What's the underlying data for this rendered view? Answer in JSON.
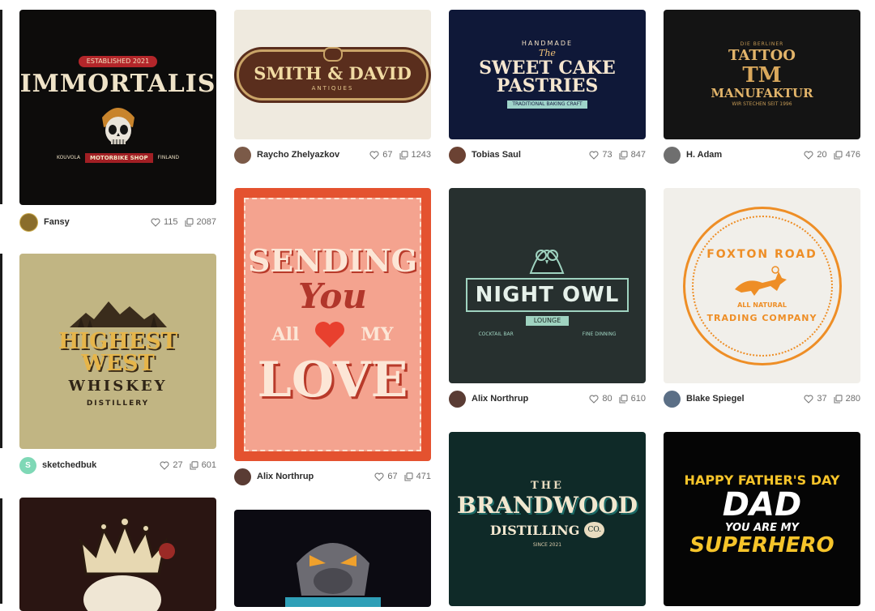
{
  "shots": [
    {
      "author": "Fansy",
      "avatar_letter": "",
      "avatar_color": "#8a6d2b",
      "likes": "115",
      "views": "2087",
      "art_lines": [
        "ESTABLISHED 2021",
        "IMMORTALIS",
        "KOUVOLA",
        "MOTORBIKE SHOP",
        "FINLAND"
      ]
    },
    {
      "author": "sketchedbuk",
      "avatar_letter": "S",
      "avatar_color": "#7fd8b6",
      "likes": "27",
      "views": "601",
      "art_lines": [
        "HIGHEST WEST",
        "WHISKEY",
        "DISTILLERY"
      ]
    },
    {
      "author": "Raycho Zhelyazkov",
      "avatar_letter": "",
      "avatar_color": "#7b5a48",
      "likes": "67",
      "views": "1243",
      "art_lines": [
        "SMITH & DAVID",
        "ANTIQUES"
      ]
    },
    {
      "author": "Alix Northrup",
      "avatar_letter": "",
      "avatar_color": "#5a3c34",
      "likes": "67",
      "views": "471",
      "art_lines": [
        "SENDING",
        "You",
        "All",
        "MY",
        "LOVE"
      ]
    },
    {
      "author": "Tobias Saul",
      "avatar_letter": "",
      "avatar_color": "#6b4233",
      "likes": "73",
      "views": "847",
      "art_lines": [
        "HANDMADE",
        "The",
        "SWEET CAKE",
        "PASTRIES",
        "TRADITIONAL BAKING CRAFT"
      ]
    },
    {
      "author": "Alix Northrup",
      "avatar_letter": "",
      "avatar_color": "#5a3c34",
      "likes": "80",
      "views": "610",
      "art_lines": [
        "NIGHT OWL",
        "LOUNGE",
        "COCKTAIL BAR",
        "FINE DINNING"
      ]
    },
    {
      "author": "H. Adam",
      "avatar_letter": "",
      "avatar_color": "#6f6f6f",
      "likes": "20",
      "views": "476",
      "art_lines": [
        "DIE BERLINER",
        "TATTOO",
        "MANUFAKTUR",
        "WIR STECHEN SEIT 1996"
      ]
    },
    {
      "author": "Blake Spiegel",
      "avatar_letter": "",
      "avatar_color": "#5b6f86",
      "likes": "37",
      "views": "280",
      "art_lines": [
        "FOXTON ROAD",
        "ALL NATURAL",
        "TRADING COMPANY"
      ]
    },
    {
      "author": "",
      "avatar_letter": "",
      "avatar_color": "#000000",
      "likes": "",
      "views": "",
      "art_lines": []
    },
    {
      "author": "",
      "avatar_letter": "",
      "avatar_color": "#000000",
      "likes": "",
      "views": "",
      "art_lines": []
    },
    {
      "author": "",
      "avatar_letter": "",
      "avatar_color": "#000000",
      "likes": "",
      "views": "",
      "art_lines": [
        "THE",
        "BRANDWOOD",
        "DISTILLING",
        "CO.",
        "SINCE 2021"
      ]
    },
    {
      "author": "",
      "avatar_letter": "",
      "avatar_color": "#000000",
      "likes": "",
      "views": "",
      "art_lines": [
        "HAPPY FATHER'S DAY",
        "DAD",
        "YOU ARE MY",
        "SUPERHERO"
      ]
    }
  ],
  "icons": {
    "like": "heart-icon",
    "views": "copy-icon"
  }
}
